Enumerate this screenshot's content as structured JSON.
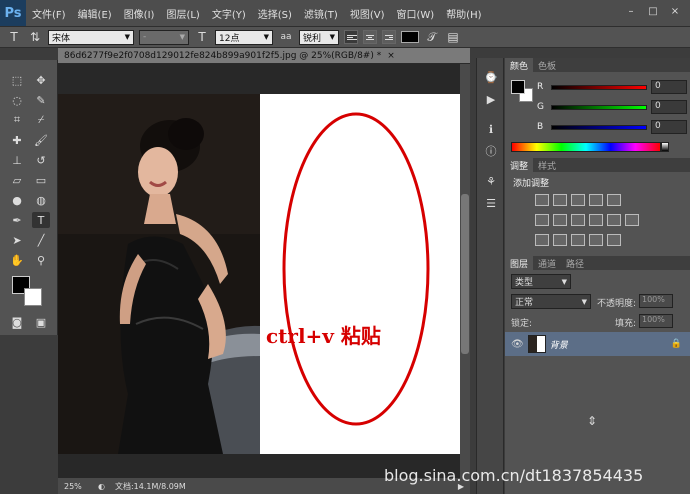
{
  "app": {
    "logo": "Ps"
  },
  "menu": [
    "文件(F)",
    "编辑(E)",
    "图像(I)",
    "图层(L)",
    "文字(Y)",
    "选择(S)",
    "滤镜(T)",
    "视图(V)",
    "窗口(W)",
    "帮助(H)"
  ],
  "window_controls": {
    "minimize": "–",
    "restore": "□",
    "close": "×"
  },
  "options_bar": {
    "tool_icon": "T",
    "font_family": "宋体",
    "font_style": "-",
    "font_size": "12点",
    "aa_label": "aa",
    "antialias": "锐利",
    "color": "#000000"
  },
  "document": {
    "tab_title": "86d6277f9e2f0708d129012fe824b899a901f2f5.jpg @ 25%(RGB/8#) *",
    "annotation": "ctrl+v 粘贴",
    "annotation_color": "#d60000"
  },
  "status": {
    "zoom": "25%",
    "doc_size": "文档:14.1M/8.09M"
  },
  "watermark": "blog.sina.com.cn/dt1837854435",
  "color_panel": {
    "tabs": [
      "颜色",
      "色板"
    ],
    "rows": [
      {
        "label": "R",
        "value": "0"
      },
      {
        "label": "G",
        "value": "0"
      },
      {
        "label": "B",
        "value": "0"
      }
    ]
  },
  "adjustments_panel": {
    "tabs": [
      "调整",
      "样式"
    ],
    "title": "添加调整"
  },
  "layers_panel": {
    "tabs": [
      "图层",
      "通道",
      "路径"
    ],
    "filter_label": "类型",
    "blend_mode": "正常",
    "opacity_label": "不透明度:",
    "opacity_value": "100%",
    "lock_label": "锁定:",
    "fill_label": "填充:",
    "fill_value": "100%",
    "layer_name": "背景"
  }
}
